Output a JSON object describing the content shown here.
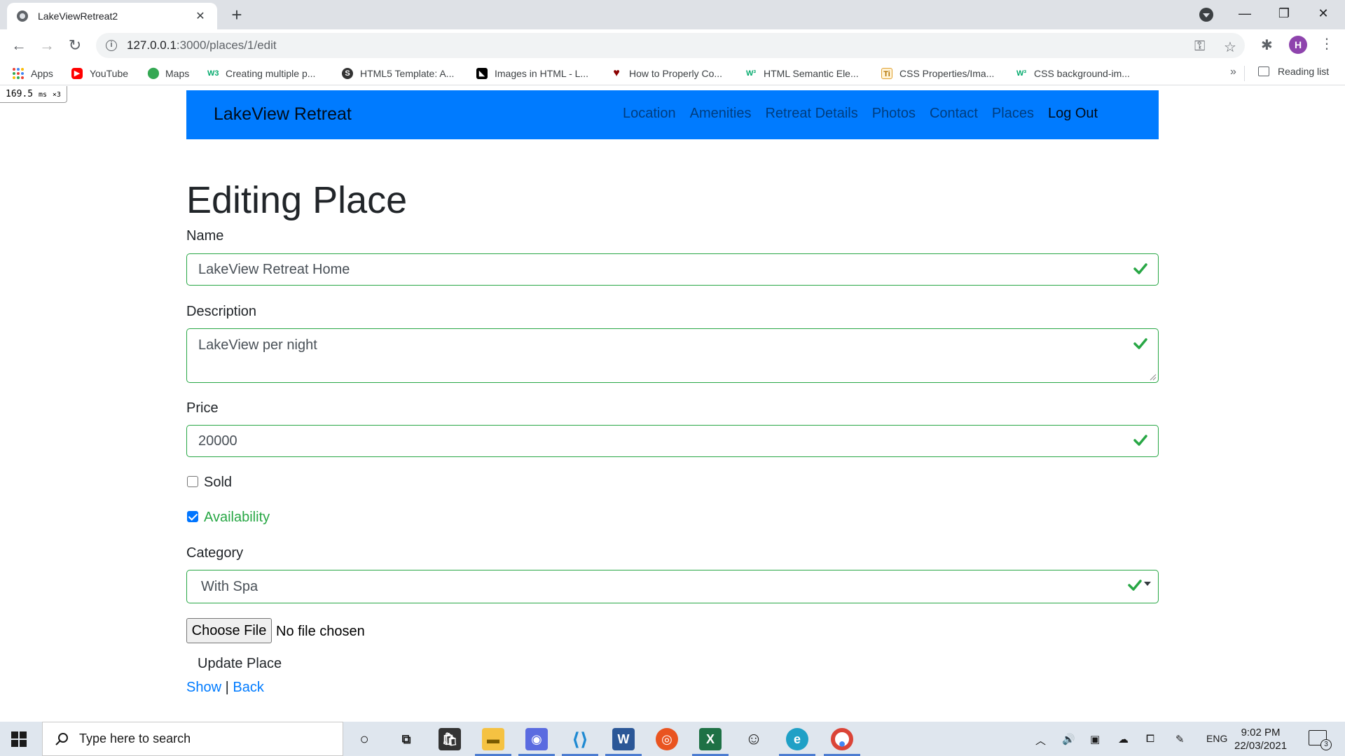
{
  "browser": {
    "tab_title": "LakeViewRetreat2",
    "tab_close": "✕",
    "new_tab": "+",
    "url_host": "127.0.0.1",
    "url_path": ":3000/places/1/edit",
    "profile_initial": "H",
    "minimize": "—",
    "restore": "❐",
    "close": "✕"
  },
  "bookmarks": [
    {
      "label": "Apps",
      "icon": "apps-grid-icon"
    },
    {
      "label": "YouTube",
      "icon": "youtube-icon",
      "color": "#ff0000"
    },
    {
      "label": "Maps",
      "icon": "maps-pin-icon",
      "color": "#34a853"
    },
    {
      "label": "Creating multiple p...",
      "icon": "w3schools-icon",
      "color": "#04aa6d"
    },
    {
      "label": "HTML5 Template: A...",
      "icon": "sitepoint-icon",
      "color": "#333333"
    },
    {
      "label": "Images in HTML - L...",
      "icon": "mdn-icon",
      "color": "#000000"
    },
    {
      "label": "How to Properly Co...",
      "icon": "heart-icon",
      "color": "#8b0000"
    },
    {
      "label": "HTML Semantic Ele...",
      "icon": "w3-icon",
      "color": "#04aa6d"
    },
    {
      "label": "CSS Properties/Ima...",
      "icon": "ti-icon",
      "color": "#e0a030"
    },
    {
      "label": "CSS background-im...",
      "icon": "w3-icon",
      "color": "#04aa6d"
    }
  ],
  "bookmarks_more": "»",
  "reading_list": "Reading list",
  "perf": {
    "value": "169.5",
    "unit": "ms",
    "mult": "×3"
  },
  "site": {
    "brand": "LakeView Retreat",
    "nav": [
      "Location",
      "Amenities",
      "Retreat Details",
      "Photos",
      "Contact",
      "Places",
      "Log Out"
    ]
  },
  "form": {
    "title": "Editing Place",
    "name_label": "Name",
    "name_value": "LakeView Retreat Home",
    "description_label": "Description",
    "description_value": "LakeView per night",
    "price_label": "Price",
    "price_value": "20000",
    "sold_label": "Sold",
    "sold_checked": false,
    "availability_label": "Availability",
    "availability_checked": true,
    "category_label": "Category",
    "category_value": "With Spa",
    "file_button": "Choose File",
    "file_status": "No file chosen",
    "submit": "Update Place",
    "show_link": "Show",
    "separator": "|",
    "back_link": "Back",
    "valid_color": "#28a745"
  },
  "taskbar": {
    "search_placeholder": "Type here to search",
    "lang": "ENG",
    "time": "9:02 PM",
    "date": "22/03/2021",
    "notifications": "3"
  }
}
